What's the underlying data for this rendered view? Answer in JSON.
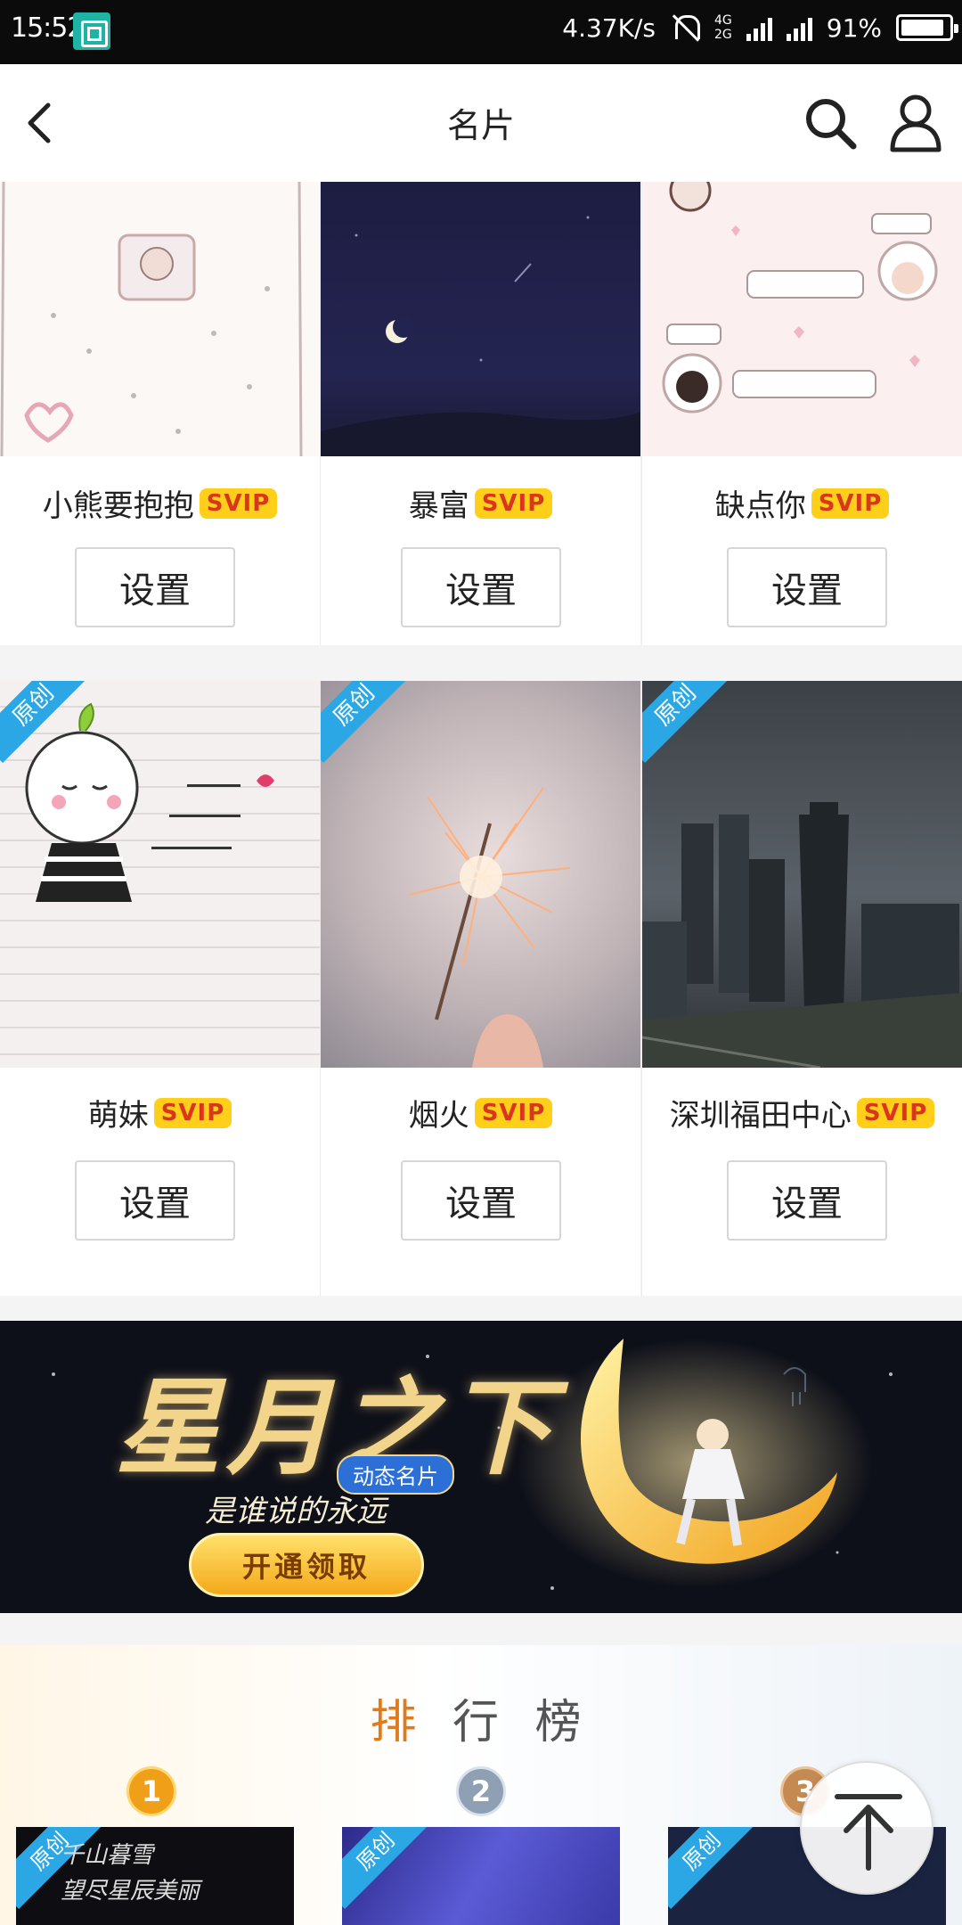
{
  "status_bar": {
    "time": "15:52",
    "net_speed": "4.37K/s",
    "sig_top": "4G",
    "sig_bottom": "2G",
    "battery": "91%"
  },
  "header": {
    "title": "名片"
  },
  "cards": [
    {
      "name": "小熊要抱抱",
      "badge": "SVIP",
      "button": "设置",
      "original": ""
    },
    {
      "name": "暴富",
      "badge": "SVIP",
      "button": "设置",
      "original": ""
    },
    {
      "name": "缺点你",
      "badge": "SVIP",
      "button": "设置",
      "original": ""
    },
    {
      "name": "萌妹",
      "badge": "SVIP",
      "button": "设置",
      "original": "原创"
    },
    {
      "name": "烟火",
      "badge": "SVIP",
      "button": "设置",
      "original": "原创"
    },
    {
      "name": "深圳福田中心",
      "badge": "SVIP",
      "button": "设置",
      "original": "原创"
    }
  ],
  "banner": {
    "title": "星月之下",
    "pill": "动态名片",
    "slogan": "是谁说的永远",
    "cta": "开通领取"
  },
  "ranking": {
    "title_a": "排",
    "title_b": "行 榜",
    "items": [
      {
        "rank": "1",
        "original": "原创",
        "text_line1": "千山暮雪",
        "text_line2": "望尽星辰美丽"
      },
      {
        "rank": "2",
        "original": "原创",
        "text_line1": "",
        "text_line2": ""
      },
      {
        "rank": "3",
        "original": "原创",
        "text_line1": "",
        "text_line2": ""
      }
    ]
  },
  "colors": {
    "accent_svip_bg": "#ffcf1a",
    "accent_svip_text": "#d9361e",
    "original_badge": "#2aa7e4",
    "rank_title_accent": "#e07b1a"
  }
}
